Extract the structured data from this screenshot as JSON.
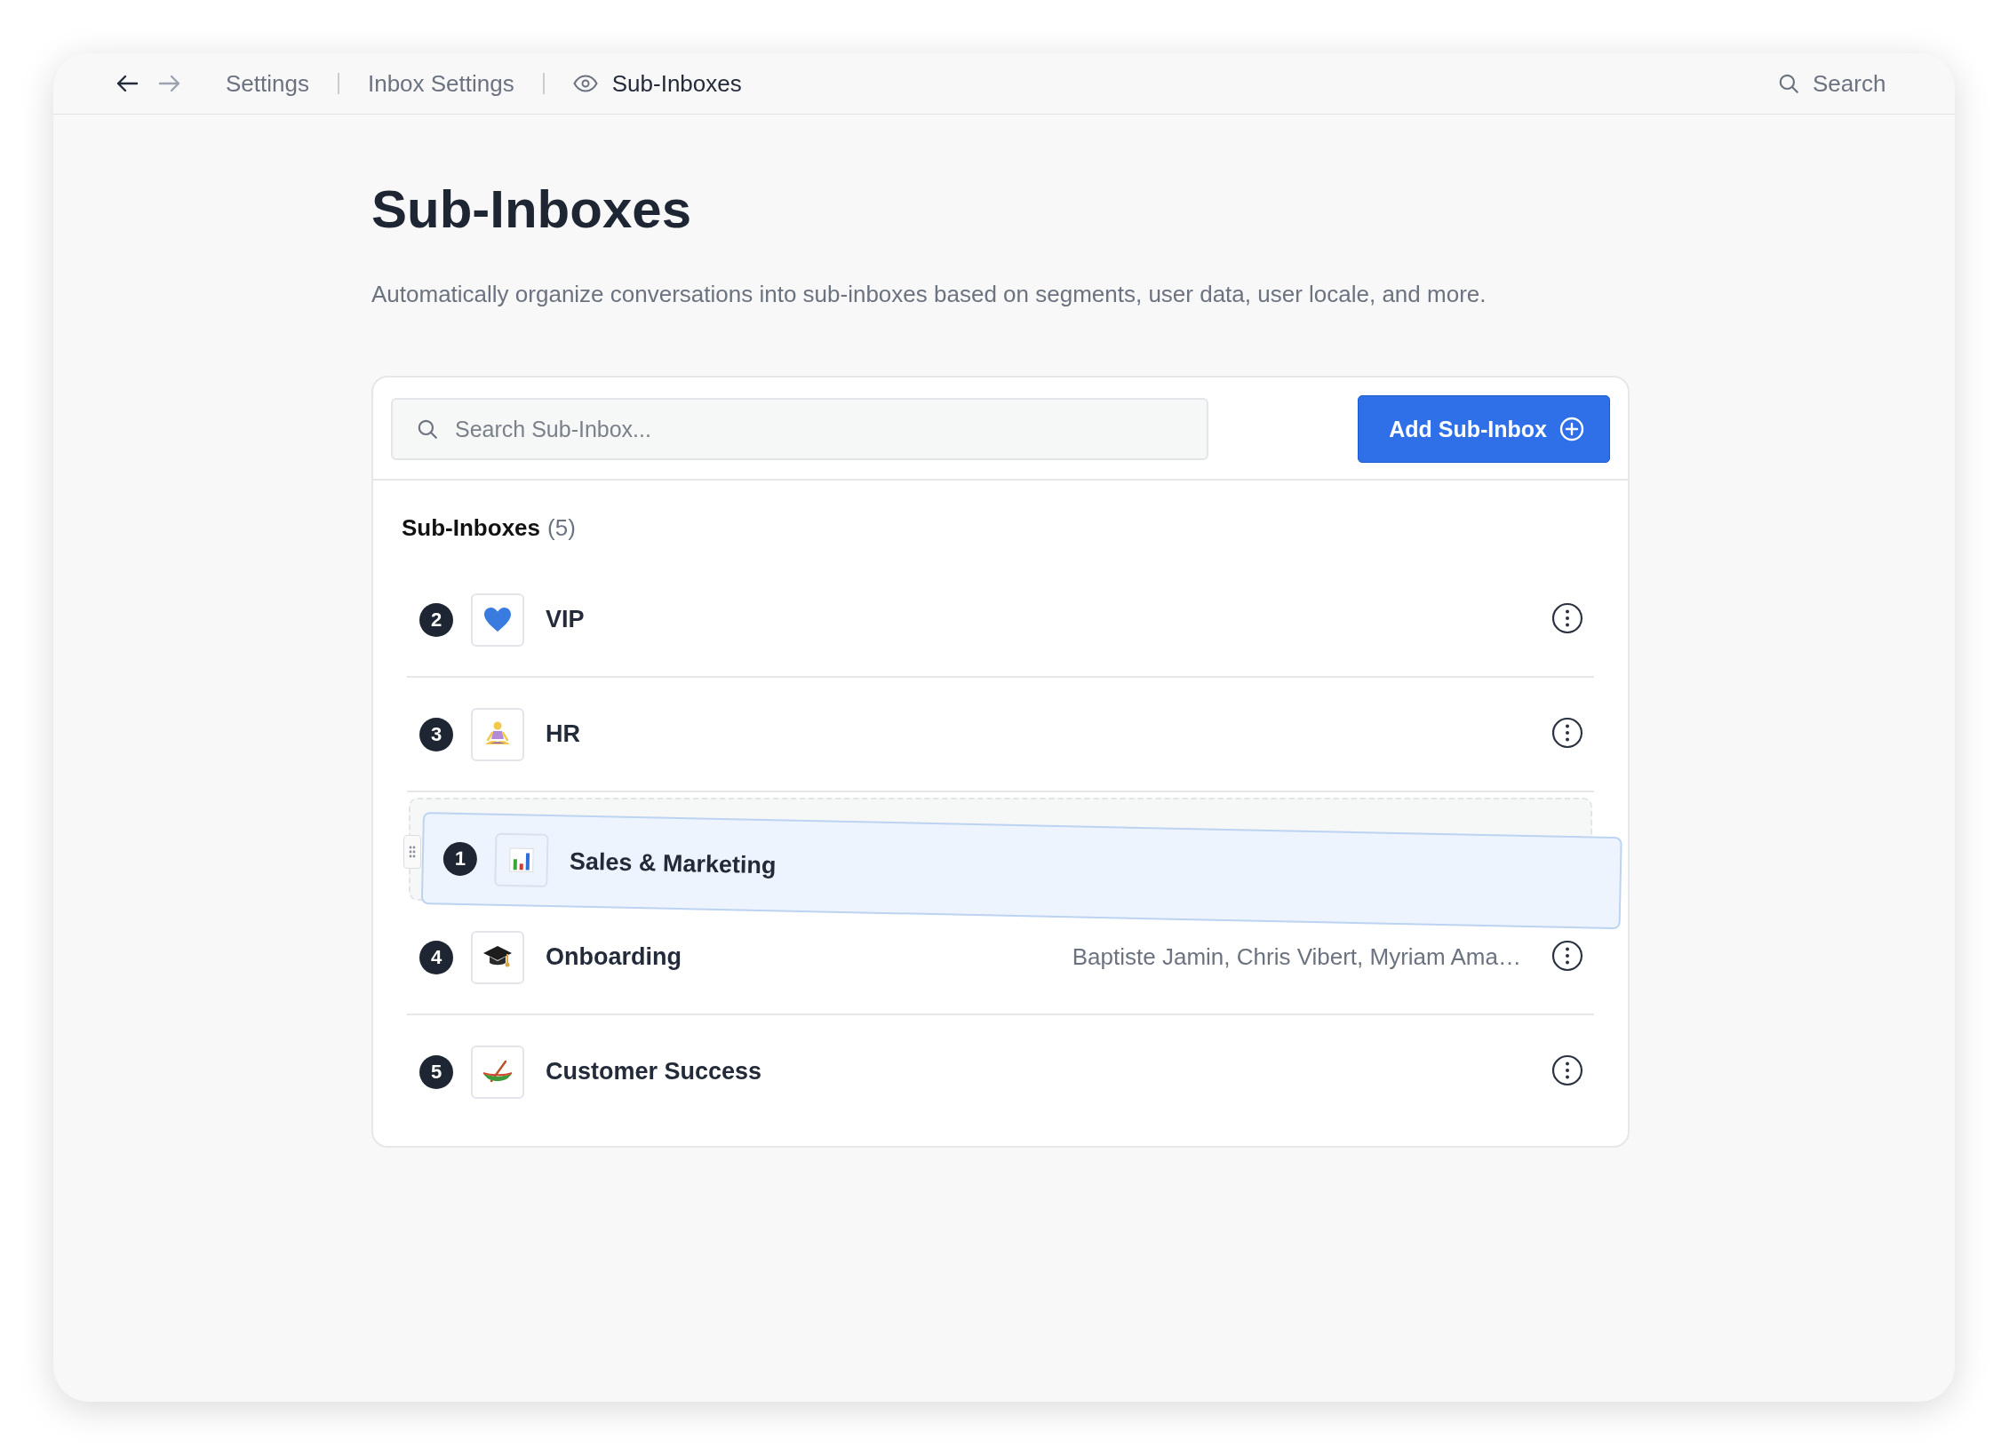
{
  "nav": {
    "back_disabled": false,
    "forward_disabled": true
  },
  "breadcrumbs": [
    {
      "label": "Settings",
      "current": false
    },
    {
      "label": "Inbox Settings",
      "current": false
    },
    {
      "label": "Sub-Inboxes",
      "current": true
    }
  ],
  "top_search": {
    "placeholder": "Search"
  },
  "page": {
    "title": "Sub-Inboxes",
    "description": "Automatically organize conversations into sub-inboxes based on segments, user data, user locale, and more."
  },
  "panel": {
    "search": {
      "placeholder": "Search Sub-Inbox..."
    },
    "add_button": "Add Sub-Inbox",
    "list_title": "Sub-Inboxes",
    "count": "(5)"
  },
  "items": [
    {
      "number": "2",
      "name": "VIP",
      "dragging": false
    },
    {
      "number": "3",
      "name": "HR",
      "dragging": false
    },
    {
      "number": "1",
      "name": "Sales & Marketing",
      "dragging": true
    },
    {
      "number": "4",
      "name": "Onboarding",
      "assignees": "Baptiste Jamin, Chris Vibert, Myriam Ama…",
      "dragging": false
    },
    {
      "number": "5",
      "name": "Customer Success",
      "dragging": false
    }
  ]
}
